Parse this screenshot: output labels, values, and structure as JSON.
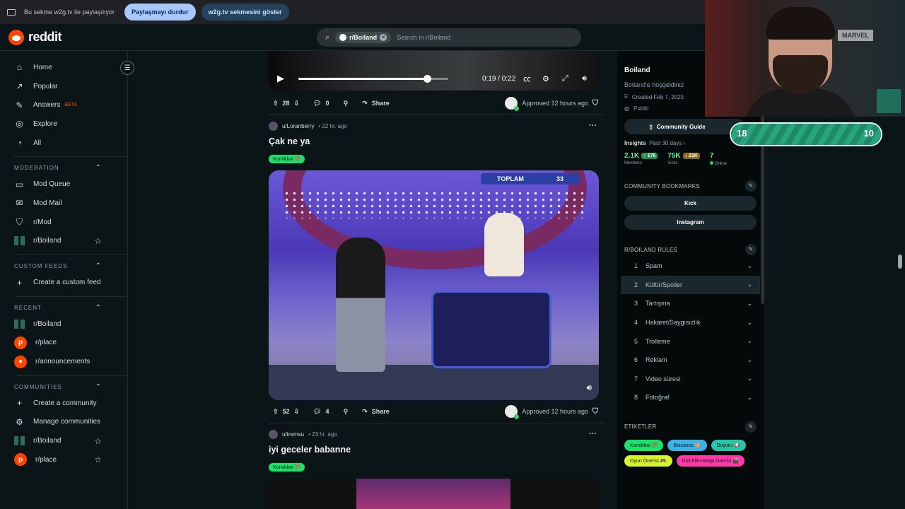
{
  "sharebar": {
    "message": "Bu sekme w2g.tv ile paylaşılıyor",
    "stop_label": "Paylaşmayı durdur",
    "show_label": "w2g.tv sekmesini göster"
  },
  "header": {
    "logo": "reddit",
    "search_chip": "r/Boiland",
    "search_placeholder": "Search in r/Boiland"
  },
  "sidebar": {
    "main": [
      {
        "label": "Home",
        "icon": "home-icon"
      },
      {
        "label": "Popular",
        "icon": "popular-icon"
      },
      {
        "label": "Answers",
        "icon": "answers-icon",
        "badge": "BETA"
      },
      {
        "label": "Explore",
        "icon": "explore-icon"
      },
      {
        "label": "All",
        "icon": "all-icon"
      }
    ],
    "moderation_title": "MODERATION",
    "moderation": [
      "Mod Queue",
      "Mod Mail",
      "r/Mod",
      "r/Boiland"
    ],
    "custom_feeds_title": "CUSTOM FEEDS",
    "custom_feed_create": "Create a custom feed",
    "recent_title": "RECENT",
    "recent": [
      "r/Boiland",
      "r/place",
      "r/announcements"
    ],
    "communities_title": "COMMUNITIES",
    "communities": [
      "Create a community",
      "Manage communities",
      "r/Boiland",
      "r/place"
    ]
  },
  "player": {
    "time": "0:19 / 0:22",
    "progress": 0.86
  },
  "posts": [
    {
      "upvotes": "28",
      "comments": "0",
      "share": "Share",
      "approved": "Approved 12 hours ago"
    },
    {
      "user": "u/Loranberry",
      "time": "• 22 hr. ago",
      "title": "Çak ne ya",
      "flair": "Komikboi 💯",
      "video_board_left": "TOPLAM",
      "video_board_right": "33",
      "upvotes": "52",
      "comments": "4",
      "share": "Share",
      "approved": "Approved 12 hours ago"
    },
    {
      "user": "u/tremsu",
      "time": "• 23 hr. ago",
      "title": "iyi geceler babanne",
      "flair": "Komikboi 💯"
    }
  ],
  "right": {
    "name": "Boiland",
    "welcome": "Boiland'e hoşgeldiniz",
    "created": "Created Feb 7, 2025",
    "visibility": "Public",
    "guide": "Community Guide",
    "insights": "Insights",
    "period": "Past 30 days ›",
    "members_value": "2.1K",
    "members_delta": "↑ 176",
    "members_label": "Members",
    "visits_value": "75K",
    "visits_delta": "↓ 21K",
    "visits_label": "Visits",
    "online_value": "7",
    "online_label": "Online",
    "bookmarks_title": "COMMUNITY BOOKMARKS",
    "bookmarks": [
      "Kick",
      "Instagram"
    ],
    "rules_title": "R/BOILAND RULES",
    "rules": [
      "Spam",
      "Küfür/Spoiler",
      "Tartışma",
      "Hakaret/Saygısızlık",
      "Trolleme",
      "Reklam",
      "Video süresi",
      "Fotoğraf"
    ],
    "tags_title": "ETIKETLER",
    "tags": [
      {
        "label": "Komikboi 💯",
        "color": "#19e36b"
      },
      {
        "label": "Boicasso 🎨",
        "color": "#3bb3e8"
      },
      {
        "label": "Duyuru 📢",
        "color": "#28c4a8"
      },
      {
        "label": "Oyun Önerisi 🎮",
        "color": "#d8f52a"
      },
      {
        "label": "Dizi-Film-Kitap Önerisi 🎬",
        "color": "#ff3aa8"
      }
    ]
  },
  "overlay": {
    "score_left": "18",
    "score_right": "10",
    "poster": "MARVEL"
  }
}
